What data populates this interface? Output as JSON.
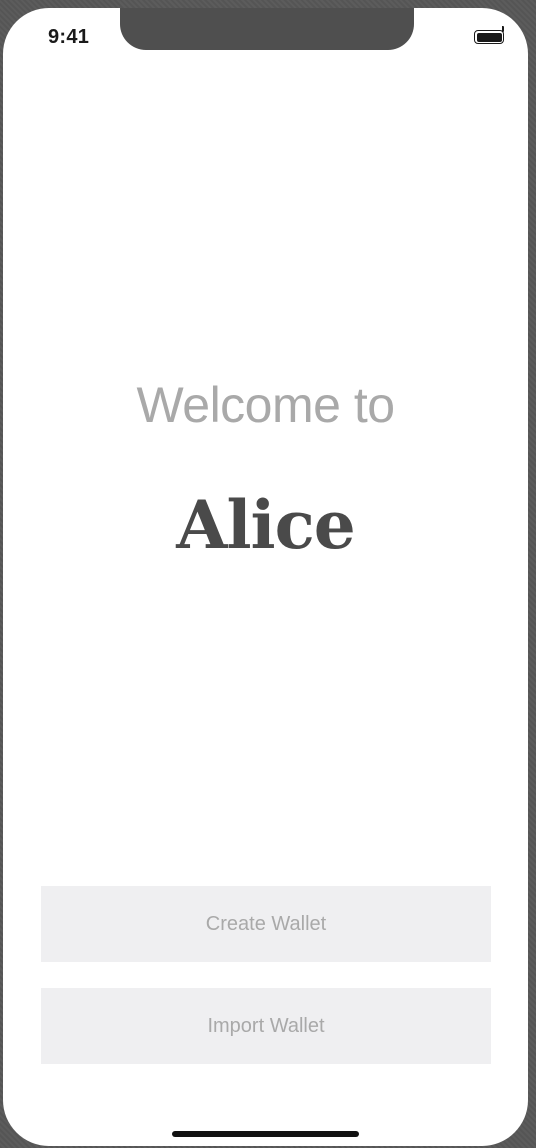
{
  "status_bar": {
    "time": "9:41",
    "battery_icon": "battery-full-icon"
  },
  "main": {
    "welcome_text": "Welcome to",
    "app_name": "Alice"
  },
  "actions": {
    "create_label": "Create Wallet",
    "import_label": "Import Wallet"
  },
  "colors": {
    "background": "#ffffff",
    "welcome_text": "#a9a9a9",
    "app_name": "#4a4a4a",
    "button_bg": "#efeff1",
    "button_text": "#a9a9a9"
  }
}
